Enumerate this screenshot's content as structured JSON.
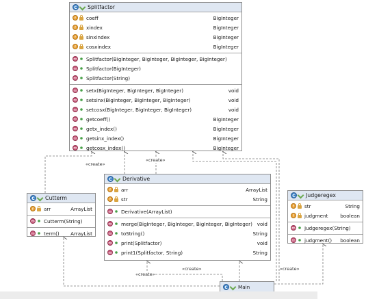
{
  "classes": {
    "splitfactor": {
      "title": "Splitfactor",
      "fields": [
        {
          "name": "coeff",
          "type": "BigInteger"
        },
        {
          "name": "xindex",
          "type": "BigInteger"
        },
        {
          "name": "sinxindex",
          "type": "BigInteger"
        },
        {
          "name": "cosxindex",
          "type": "BigInteger"
        }
      ],
      "constructors": [
        {
          "name": "Splitfactor(BigInteger, BigInteger, BigInteger, BigInteger)"
        },
        {
          "name": "Splitfactor(BigInteger)"
        },
        {
          "name": "Splitfactor(String)"
        }
      ],
      "methods": [
        {
          "name": "setx(BigInteger, BigInteger, BigInteger)",
          "type": "void"
        },
        {
          "name": "setsinx(BigInteger, BigInteger, BigInteger)",
          "type": "void"
        },
        {
          "name": "setcosx(BigInteger, BigInteger, BigInteger)",
          "type": "void"
        },
        {
          "name": "getcoeff()",
          "type": "BigInteger"
        },
        {
          "name": "getx_index()",
          "type": "BigInteger"
        },
        {
          "name": "getsinx_index()",
          "type": "BigInteger"
        },
        {
          "name": "getcosx_index()",
          "type": "BigInteger"
        }
      ]
    },
    "cutterm": {
      "title": "Cutterm",
      "fields": [
        {
          "name": "arr",
          "type": "ArrayList"
        }
      ],
      "constructors": [
        {
          "name": "Cutterm(String)"
        }
      ],
      "methods": [
        {
          "name": "term()",
          "type": "ArrayList"
        }
      ]
    },
    "derivative": {
      "title": "Derivative",
      "fields": [
        {
          "name": "arr",
          "type": "ArrayList"
        },
        {
          "name": "str",
          "type": "String"
        }
      ],
      "constructors": [
        {
          "name": "Derivative(ArrayList)"
        }
      ],
      "methods": [
        {
          "name": "merge(BigInteger, BigInteger, BigInteger, BigInteger)",
          "type": "void"
        },
        {
          "name": "toString()",
          "type": "String"
        },
        {
          "name": "print(Splitfactor)",
          "type": "void"
        },
        {
          "name": "print1(Splitfactor, String)",
          "type": "String"
        }
      ]
    },
    "judgeregex": {
      "title": "Judgeregex",
      "fields": [
        {
          "name": "str",
          "type": "String"
        },
        {
          "name": "judgment",
          "type": "boolean"
        }
      ],
      "constructors": [
        {
          "name": "Judgeregex(String)"
        }
      ],
      "methods": [
        {
          "name": "judgment()",
          "type": "boolean"
        }
      ]
    },
    "main": {
      "title": "Main"
    }
  },
  "relations": {
    "create_label": "«create»"
  },
  "icons": {
    "class": "class-icon",
    "field": "private-field-icon",
    "method": "public-method-icon"
  },
  "colors": {
    "header_bg": "#dfe7f2",
    "class_icon": "#3c82c8",
    "field_icon": "#e8a23a",
    "method_icon": "#c8587a"
  }
}
